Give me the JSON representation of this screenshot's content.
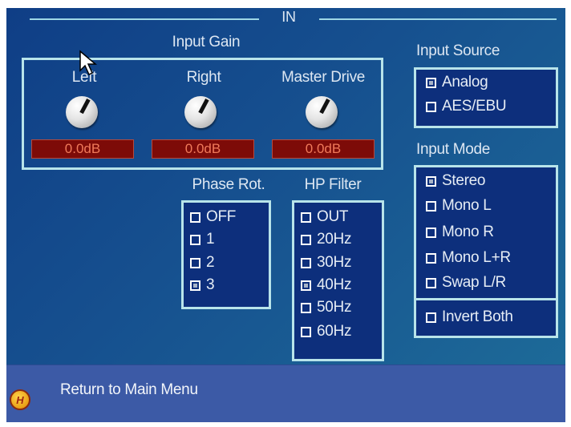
{
  "section_title": "IN",
  "input_gain": {
    "title": "Input Gain",
    "knobs": [
      {
        "label": "Left",
        "value": "0.0dB"
      },
      {
        "label": "Right",
        "value": "0.0dB"
      },
      {
        "label": "Master Drive",
        "value": "0.0dB"
      }
    ]
  },
  "input_source": {
    "title": "Input Source",
    "options": [
      {
        "label": "Analog",
        "checked": true
      },
      {
        "label": "AES/EBU",
        "checked": false
      }
    ]
  },
  "input_mode": {
    "title": "Input Mode",
    "options": [
      {
        "label": "Stereo",
        "checked": true
      },
      {
        "label": "Mono L",
        "checked": false
      },
      {
        "label": "Mono R",
        "checked": false
      },
      {
        "label": "Mono L+R",
        "checked": false
      },
      {
        "label": "Swap L/R",
        "checked": false
      }
    ],
    "invert": {
      "label": "Invert Both",
      "checked": false
    }
  },
  "phase_rot": {
    "title": "Phase Rot.",
    "options": [
      {
        "label": "OFF",
        "checked": false
      },
      {
        "label": "1",
        "checked": false
      },
      {
        "label": "2",
        "checked": false
      },
      {
        "label": "3",
        "checked": true
      }
    ]
  },
  "hp_filter": {
    "title": "HP Filter",
    "options": [
      {
        "label": "OUT",
        "checked": false
      },
      {
        "label": "20Hz",
        "checked": false
      },
      {
        "label": "30Hz",
        "checked": false
      },
      {
        "label": "40Hz",
        "checked": true
      },
      {
        "label": "50Hz",
        "checked": false
      },
      {
        "label": "60Hz",
        "checked": false
      }
    ]
  },
  "footer": {
    "help_icon_glyph": "H",
    "text": "Return to Main Menu"
  },
  "colors": {
    "panel": "#16508f",
    "box_fill": "#0d2f7c",
    "box_border": "#b8e4ea",
    "value_display": "#7d0b08",
    "value_text": "#f07a5a"
  }
}
